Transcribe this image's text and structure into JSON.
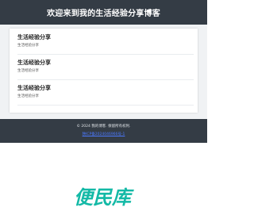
{
  "header": {
    "title": "欢迎来到我的生活经验分享博客"
  },
  "posts": [
    {
      "title": "生活经验分享",
      "desc": "生活经验分享"
    },
    {
      "title": "生活经验分享",
      "desc": "生活经验分享"
    },
    {
      "title": "生活经验分享",
      "desc": "生活经验分享"
    }
  ],
  "footer": {
    "copyright": "© 2024 我的博客. 保留所有权利.",
    "link": "陕ICP备2024046966号-1"
  },
  "watermark": {
    "text": "便民库",
    "color": "#13b9a6"
  },
  "colors": {
    "header_bg": "#343c45",
    "page_bg": "#f0f2f4",
    "link": "#4b79ff"
  }
}
